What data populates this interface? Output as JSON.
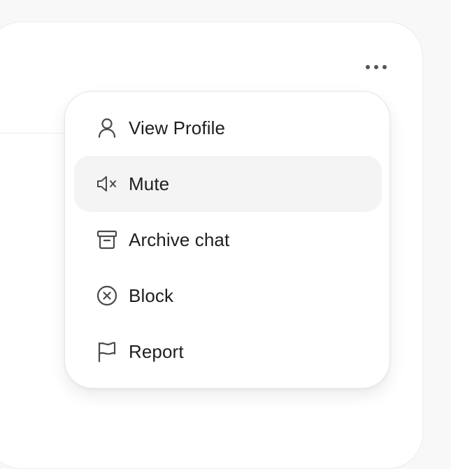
{
  "menu": {
    "items": [
      {
        "label": "View Profile",
        "icon": "user-icon"
      },
      {
        "label": "Mute",
        "icon": "speaker-mute-icon",
        "active": true
      },
      {
        "label": "Archive chat",
        "icon": "archive-icon"
      },
      {
        "label": "Block",
        "icon": "block-icon"
      },
      {
        "label": "Report",
        "icon": "flag-icon"
      }
    ]
  },
  "colors": {
    "text": "#1e1e1e",
    "icon": "#4a4a4a",
    "active_bg": "#f4f4f4",
    "page_bg": "#f8f8f8"
  }
}
